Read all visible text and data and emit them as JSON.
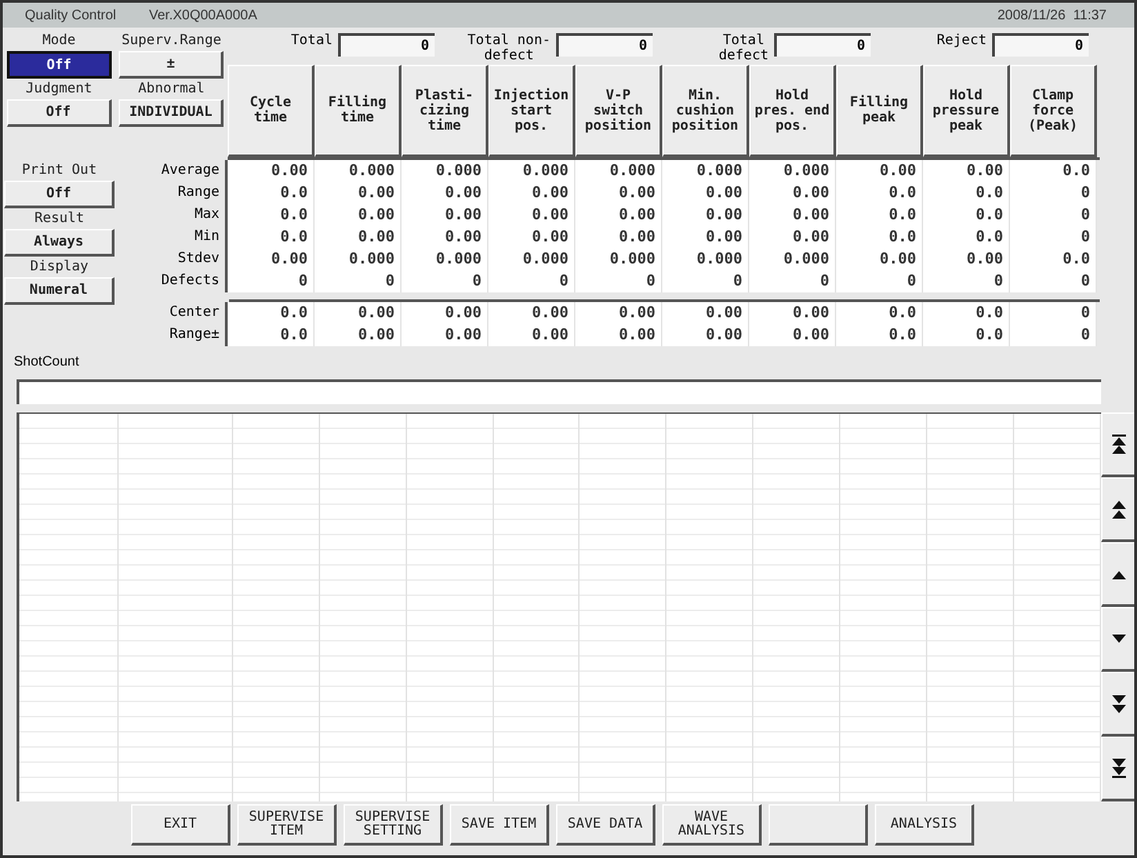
{
  "window": {
    "title": "Quality Control",
    "version": "Ver.X0Q00A000A",
    "datetime": "2008/11/26  11:37"
  },
  "settings": [
    {
      "label": "Mode",
      "value": "Off",
      "active": true
    },
    {
      "label": "Superv.Range",
      "value": "±",
      "active": false
    },
    {
      "label": "Judgment",
      "value": "Off",
      "active": false
    },
    {
      "label": "Abnormal",
      "value": "INDIVIDUAL",
      "active": false
    },
    {
      "label": "Print Out",
      "value": "Off",
      "active": false
    },
    {
      "label": "Result",
      "value": "Always",
      "active": false
    },
    {
      "label": "Display",
      "value": "Numeral",
      "active": false
    }
  ],
  "counters": [
    {
      "label": "Total",
      "value": "0"
    },
    {
      "label": "Total non-\ndefect",
      "value": "0"
    },
    {
      "label": "Total\ndefect",
      "value": "0"
    },
    {
      "label": "Reject",
      "value": "0"
    }
  ],
  "columns": [
    "Cycle\ntime",
    "Filling\ntime",
    "Plasti-\ncizing\ntime",
    "Injection\nstart\npos.",
    "V-P\nswitch\nposition",
    "Min.\ncushion\nposition",
    "Hold\npres. end\npos.",
    "Filling\npeak",
    "Hold\npressure\npeak",
    "Clamp\nforce\n(Peak)"
  ],
  "stats": [
    {
      "label": "Average",
      "values": [
        "0.00",
        "0.000",
        "0.000",
        "0.000",
        "0.000",
        "0.000",
        "0.000",
        "0.00",
        "0.00",
        "0.0"
      ]
    },
    {
      "label": "Range",
      "values": [
        "0.0",
        "0.00",
        "0.00",
        "0.00",
        "0.00",
        "0.00",
        "0.00",
        "0.0",
        "0.0",
        "0"
      ]
    },
    {
      "label": "Max",
      "values": [
        "0.0",
        "0.00",
        "0.00",
        "0.00",
        "0.00",
        "0.00",
        "0.00",
        "0.0",
        "0.0",
        "0"
      ]
    },
    {
      "label": "Min",
      "values": [
        "0.0",
        "0.00",
        "0.00",
        "0.00",
        "0.00",
        "0.00",
        "0.00",
        "0.0",
        "0.0",
        "0"
      ]
    },
    {
      "label": "Stdev",
      "values": [
        "0.00",
        "0.000",
        "0.000",
        "0.000",
        "0.000",
        "0.000",
        "0.000",
        "0.00",
        "0.00",
        "0.0"
      ]
    },
    {
      "label": "Defects",
      "values": [
        "0",
        "0",
        "0",
        "0",
        "0",
        "0",
        "0",
        "0",
        "0",
        "0"
      ]
    }
  ],
  "limits": [
    {
      "label": "Center",
      "values": [
        "0.0",
        "0.00",
        "0.00",
        "0.00",
        "0.00",
        "0.00",
        "0.00",
        "0.0",
        "0.0",
        "0"
      ]
    },
    {
      "label": "Range±",
      "values": [
        "0.0",
        "0.00",
        "0.00",
        "0.00",
        "0.00",
        "0.00",
        "0.00",
        "0.0",
        "0.0",
        "0"
      ]
    }
  ],
  "shot_count": {
    "label": "ShotCount"
  },
  "scroll_buttons": [
    {
      "kind": "top"
    },
    {
      "kind": "page-up"
    },
    {
      "kind": "up"
    },
    {
      "kind": "down"
    },
    {
      "kind": "page-down"
    },
    {
      "kind": "bottom"
    }
  ],
  "footer_buttons": [
    {
      "kind": "labeled",
      "label": "EXIT"
    },
    {
      "kind": "labeled",
      "label": "SUPERVISE\nITEM"
    },
    {
      "kind": "labeled",
      "label": "SUPERVISE\nSETTING"
    },
    {
      "kind": "labeled",
      "label": "SAVE ITEM"
    },
    {
      "kind": "labeled",
      "label": "SAVE DATA"
    },
    {
      "kind": "labeled",
      "label": "WAVE\nANALYSIS"
    },
    {
      "kind": "empty"
    },
    {
      "kind": "labeled",
      "label": "ANALYSIS"
    }
  ]
}
